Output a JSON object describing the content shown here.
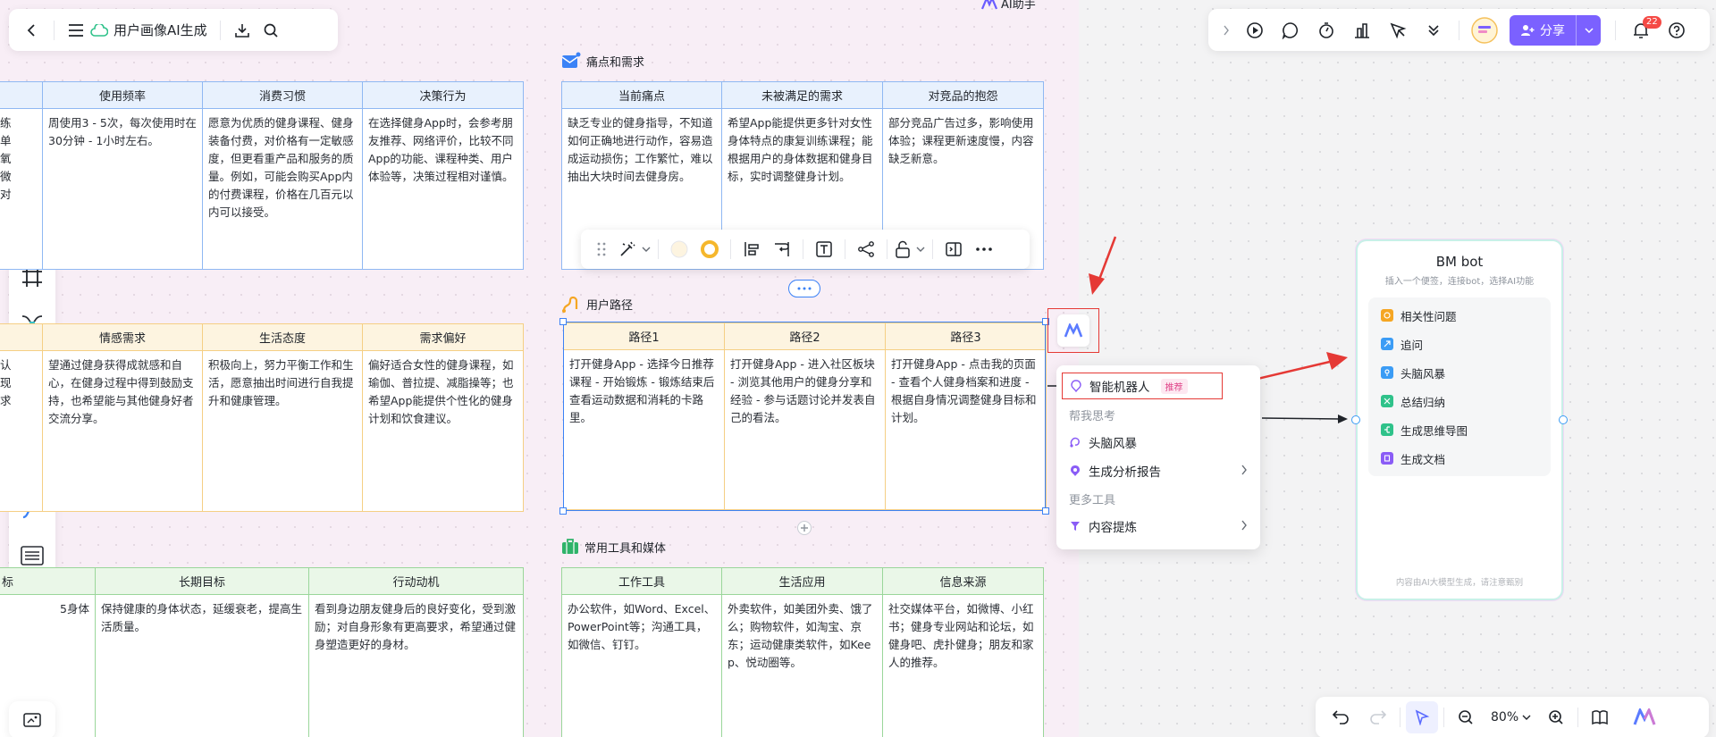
{
  "app": {
    "title": "用户画像AI生成",
    "ai_helper_label": "AI助手"
  },
  "sections": {
    "pain": {
      "label": "痛点和需求"
    },
    "path": {
      "label": "用户路径"
    },
    "tools": {
      "label": "常用工具和媒体"
    }
  },
  "left_blue": {
    "headers": [
      "使用频率",
      "消费习惯",
      "决策行为"
    ],
    "row": [
      "周使用3 - 5次，每次使用时在30分钟 - 1小时左右。",
      "愿意为优质的健身课程、健身装备付费，对价格有一定敏感度，但更看重产品和服务的质量。例如，可能会购买App内的付费课程，价格在几百元以内可以接受。",
      "在选择健身App时，会参考朋友推荐、网络评价，比较不同App的功能、课程种类、用户体验等，决策过程相对谨慎。"
    ],
    "cut_text": [
      "练",
      "单",
      "氧",
      "微",
      "对"
    ]
  },
  "left_yellow": {
    "headers": [
      "情感需求",
      "生活态度",
      "需求偏好"
    ],
    "row": [
      "望通过健身获得成就感和自心，在健身过程中得到鼓励支持，也希望能与其他健身好者交流分享。",
      "积极向上，努力平衡工作和生活，愿意抽出时间进行自我提升和健康管理。",
      "偏好适合女性的健身课程，如瑜伽、普拉提、减脂操等；也希望App能提供个性化的健身计划和饮食建议。"
    ],
    "cut_text": [
      "认",
      "现",
      "求"
    ]
  },
  "left_green": {
    "headers": [
      "标",
      "长期目标",
      "行动动机"
    ],
    "row": [
      "5身体",
      "保持健康的身体状态，延缓衰老，提高生活质量。",
      "看到身边朋友健身后的良好变化，受到激励；对自身形象有更高要求，希望通过健身塑造更好的身材。"
    ]
  },
  "pain_table": {
    "headers": [
      "当前痛点",
      "未被满足的需求",
      "对竞品的抱怨"
    ],
    "row": [
      "缺乏专业的健身指导，不知道如何正确地进行动作，容易造成运动损伤；工作繁忙，难以抽出大块时间去健身房。",
      "希望App能提供更多针对女性身体特点的康复训练课程；能根据用户的身体数据和健身目标，实时调整健身计划。",
      "部分竞品广告过多，影响使用体验；课程更新速度慢，内容缺乏新意。"
    ]
  },
  "path_table": {
    "headers": [
      "路径1",
      "路径2",
      "路径3"
    ],
    "row": [
      "打开健身App - 选择今日推荐课程 - 开始锻炼 - 锻炼结束后查看运动数据和消耗的卡路里。",
      "打开健身App - 进入社区板块 - 浏览其他用户的健身分享和经验 - 参与话题讨论并发表自己的看法。",
      "打开健身App - 点击我的页面 - 查看个人健身档案和进度 - 根据自身情况调整健身目标和计划。"
    ]
  },
  "tools_table": {
    "headers": [
      "工作工具",
      "生活应用",
      "信息来源"
    ],
    "row": [
      "办公软件，如Word、Excel、PowerPoint等；沟通工具，如微信、钉钉。",
      "外卖软件，如美团外卖、饿了么；购物软件，如淘宝、京东；运动健康类软件，如Keep、悦动圈等。",
      "社交媒体平台，如微博、小红书；健身专业网站和论坛，如健身吧、虎扑健身；朋友和家人的推荐。"
    ]
  },
  "context_menu": {
    "item_bot": "智能机器人",
    "badge": "推荐",
    "head_think": "帮我思考",
    "item_brainstorm": "头脑风暴",
    "item_report": "生成分析报告",
    "head_more": "更多工具",
    "item_extract": "内容提炼"
  },
  "top_right": {
    "share_label": "分享",
    "notif_count": "22"
  },
  "bmbot": {
    "title": "BM bot",
    "subtitle": "插入一个便签，连接bot，选择AI功能",
    "items": [
      {
        "label": "相关性问题",
        "color": "#f5a623"
      },
      {
        "label": "追问",
        "color": "#3b9cf5"
      },
      {
        "label": "头脑风暴",
        "color": "#3b9cf5"
      },
      {
        "label": "总结归纳",
        "color": "#2fc28a"
      },
      {
        "label": "生成思维导图",
        "color": "#2fc28a"
      },
      {
        "label": "生成文档",
        "color": "#8a5cf6"
      }
    ],
    "footer": "内容由AI大模型生成，请注意甄别"
  },
  "bottom_bar": {
    "zoom": "80%"
  },
  "colors": {
    "accent": "#7b61ff",
    "selection": "#3b82f6",
    "annotation": "#e53935"
  }
}
